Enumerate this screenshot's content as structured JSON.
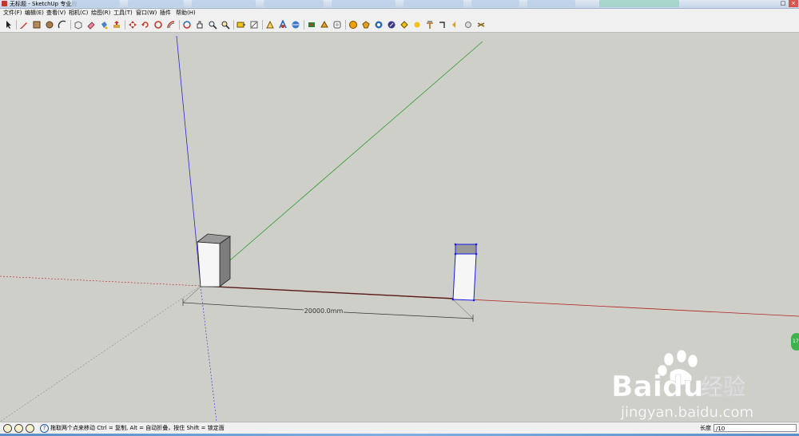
{
  "window": {
    "title": "无标题 - SketchUp 专业版",
    "app_icon": "sketchup-logo-icon"
  },
  "menu": {
    "items": [
      "文件(F)",
      "编辑(E)",
      "查看(V)",
      "相机(C)",
      "绘图(R)",
      "工具(T)",
      "窗口(W)",
      "插件",
      "帮助(H)"
    ]
  },
  "toolbar": {
    "tools": [
      "select-icon",
      "pencil-icon",
      "rectangle-icon",
      "circle-icon",
      "arc-icon",
      "make-component-icon",
      "eraser-icon",
      "paint-bucket-icon",
      "push-pull-icon",
      "move-icon",
      "rotate-icon",
      "follow-me-icon",
      "offset-icon",
      "orbit-icon",
      "pan-icon",
      "zoom-icon",
      "zoom-extents-icon",
      "tape-measure-icon",
      "dimension-icon",
      "protractor-icon",
      "text-icon",
      "axes-icon",
      "3d-text-icon",
      "section-plane-icon",
      "get-models-icon",
      "share-model-icon",
      "share-component-icon",
      "position-camera-icon",
      "walk-icon",
      "look-around-icon",
      "sandbox-icon",
      "shadow-icon",
      "fog-icon",
      "sun-icon"
    ]
  },
  "viewport": {
    "dimension_label": "20000.0mm",
    "colors": {
      "background": "#cfcfc9",
      "red_axis": "#b22222",
      "green_axis": "#2e9b2e",
      "blue_axis": "#2a2ad0",
      "selection": "#1a1ae6"
    },
    "side_badge": "17"
  },
  "watermark": {
    "brand": "Baidu",
    "brand_cn": "经验",
    "url": "jingyan.baidu.com"
  },
  "status": {
    "hint": "拖取两个点来移动 Ctrl = 复制, Alt = 自动折叠，按住 Shift = 锁定面",
    "vcb_label": "长度",
    "vcb_value": "/10"
  }
}
